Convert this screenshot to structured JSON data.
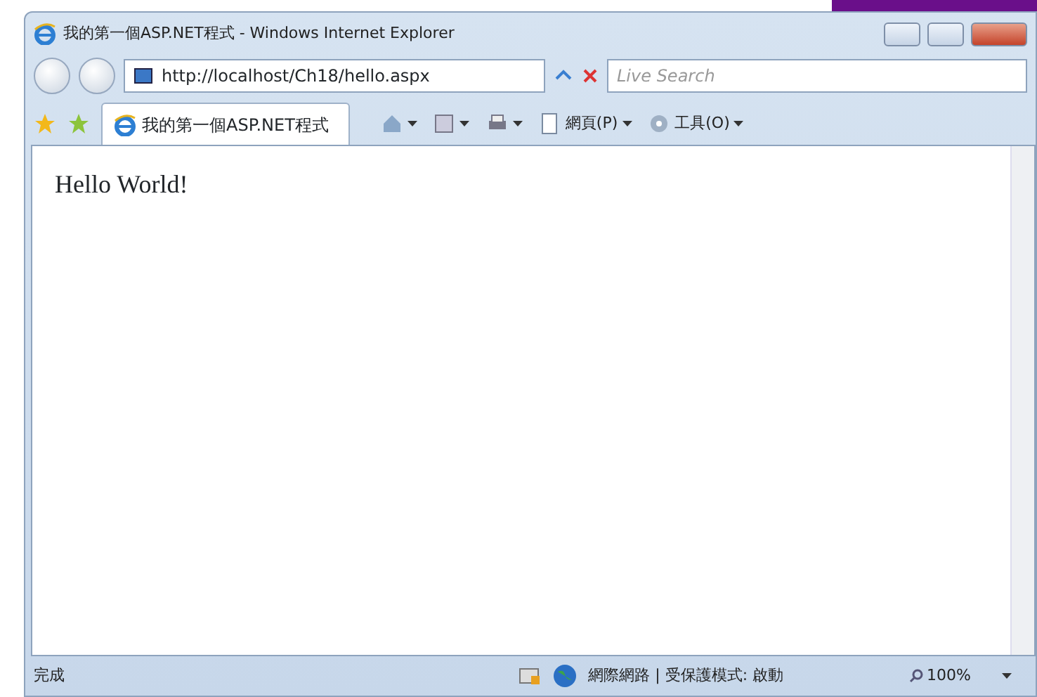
{
  "window": {
    "title": "我的第一個ASP.NET程式 - Windows Internet Explorer"
  },
  "address_bar": {
    "value": "http://localhost/Ch18/hello.aspx"
  },
  "search": {
    "placeholder": "Live Search"
  },
  "tabs": [
    {
      "label": "我的第一個ASP.NET程式",
      "selected": true
    }
  ],
  "command_bar": [
    {
      "kind": "icon"
    },
    {
      "kind": "icon"
    },
    {
      "kind": "icon"
    },
    {
      "kind": "menu",
      "label": "網頁(P)"
    },
    {
      "kind": "menu",
      "label": "工具(O)"
    }
  ],
  "page": {
    "text": "Hello World!"
  },
  "status_bar": {
    "status": "完成",
    "zone": "網際網路 | 受保護模式: 啟動",
    "zoom": "100%"
  }
}
